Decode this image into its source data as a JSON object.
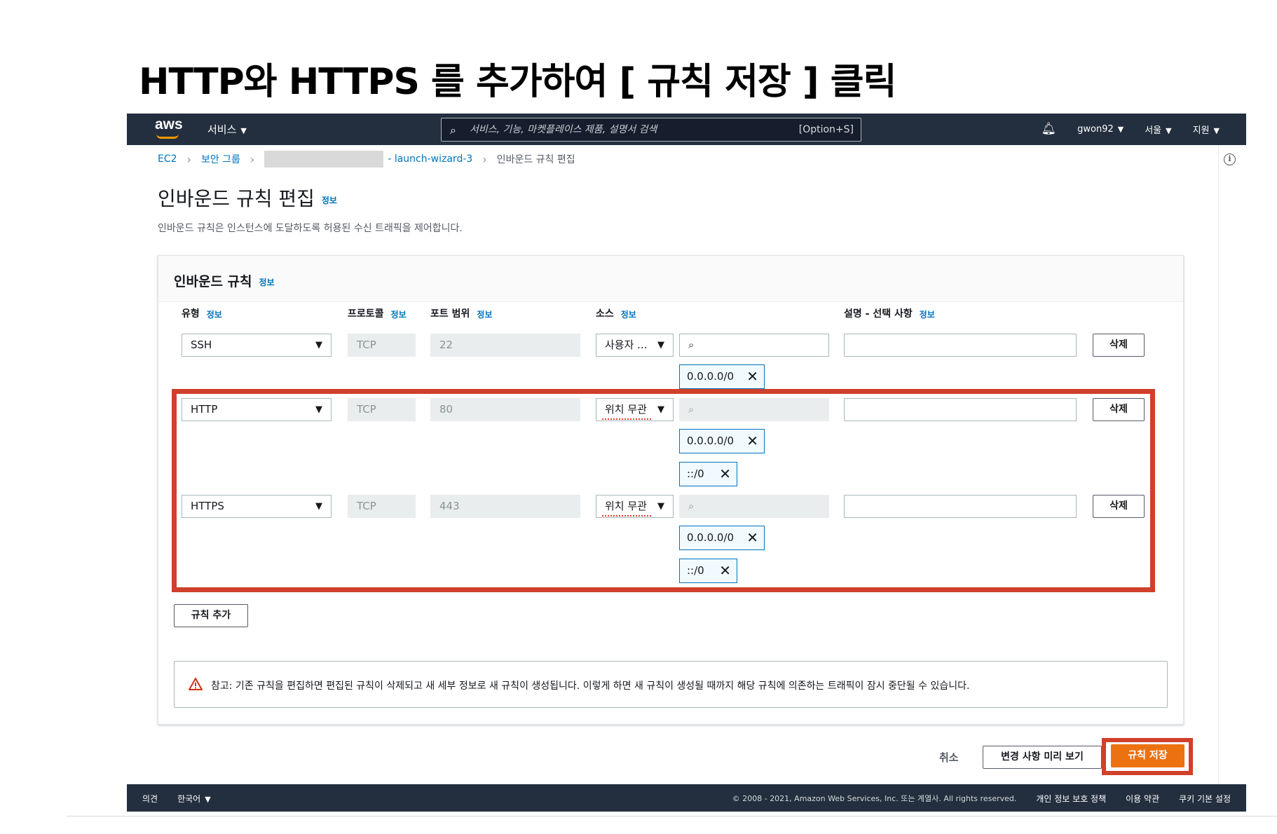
{
  "slide": {
    "title": "HTTP와 HTTPS 를 추가하여 [ 규칙 저장 ] 클릭"
  },
  "nav": {
    "logo": "aws",
    "services": "서비스",
    "search_placeholder": "서비스, 기능, 마켓플레이스 제품, 설명서 검색",
    "search_shortcut": "[Option+S]",
    "user": "gwon92",
    "region": "서울",
    "support": "지원",
    "icons": {
      "search": "search-icon",
      "bell": "bell-icon"
    }
  },
  "breadcrumb": {
    "ec2": "EC2",
    "security_groups": "보안 그룹",
    "sg_name": "- launch-wizard-3",
    "current": "인바운드 규칙 편집"
  },
  "page": {
    "title": "인바운드 규칙 편집",
    "info": "정보",
    "description": "인바운드 규칙은 인스턴스에 도달하도록 허용된 수신 트래픽을 제어합니다."
  },
  "panel": {
    "title": "인바운드 규칙",
    "info": "정보",
    "columns": {
      "type": "유형",
      "protocol": "프로토콜",
      "port_range": "포트 범위",
      "source": "소스",
      "description": "설명 - 선택 사항"
    }
  },
  "rules": [
    {
      "type": "SSH",
      "protocol": "TCP",
      "port": "22",
      "source": "사용자 ...",
      "cidrs": [
        "0.0.0.0/0"
      ],
      "delete": "삭제"
    },
    {
      "type": "HTTP",
      "protocol": "TCP",
      "port": "80",
      "source": "위치 무관",
      "cidrs": [
        "0.0.0.0/0",
        "::/0"
      ],
      "delete": "삭제"
    },
    {
      "type": "HTTPS",
      "protocol": "TCP",
      "port": "443",
      "source": "위치 무관",
      "cidrs": [
        "0.0.0.0/0",
        "::/0"
      ],
      "delete": "삭제"
    }
  ],
  "add_rule": "규칙 추가",
  "alert": "참고: 기존 규칙을 편집하면 편집된 규칙이 삭제되고 새 세부 정보로 새 규칙이 생성됩니다. 이렇게 하면 새 규칙이 생성될 때까지 해당 규칙에 의존하는 트래픽이 잠시 중단될 수 있습니다.",
  "actions": {
    "cancel": "취소",
    "preview": "변경 사항 미리 보기",
    "save": "규칙 저장"
  },
  "footer": {
    "feedback": "의견",
    "language": "한국어",
    "copyright": "© 2008 - 2021, Amazon Web Services, Inc. 또는 계열사. All rights reserved.",
    "privacy": "개인 정보 보호 정책",
    "terms": "이용 약관",
    "cookies": "쿠키 기본 설정"
  },
  "colors": {
    "nav_bg": "#232f3e",
    "link": "#0073bb",
    "primary": "#ec7211",
    "highlight": "#d0402a"
  }
}
